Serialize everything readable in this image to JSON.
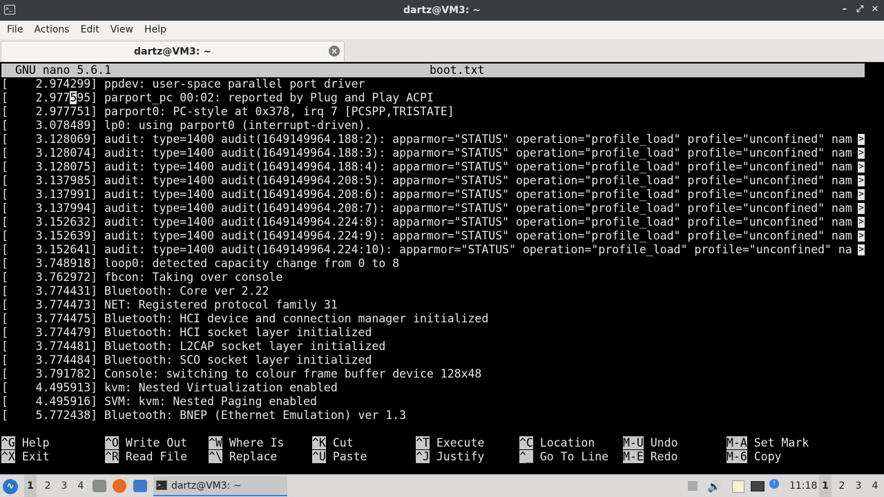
{
  "window": {
    "title": "dartz@VM3: ~"
  },
  "menu": [
    "File",
    "Actions",
    "Edit",
    "View",
    "Help"
  ],
  "tab": {
    "label": "dartz@VM3: ~"
  },
  "nano": {
    "version": "GNU nano 5.6.1",
    "filename": "boot.txt"
  },
  "lines": [
    "[    2.974299] ppdev: user-space parallel port driver",
    "[    2.977595] parport_pc 00:02: reported by Plug and Play ACPI",
    "[    2.977751] parport0: PC-style at 0x378, irq 7 [PCSPP,TRISTATE]",
    "[    3.078489] lp0: using parport0 (interrupt-driven).",
    "[    3.128069] audit: type=1400 audit(1649149964.188:2): apparmor=\"STATUS\" operation=\"profile_load\" profile=\"unconfined\" nam",
    "[    3.128074] audit: type=1400 audit(1649149964.188:3): apparmor=\"STATUS\" operation=\"profile_load\" profile=\"unconfined\" nam",
    "[    3.128075] audit: type=1400 audit(1649149964.188:4): apparmor=\"STATUS\" operation=\"profile_load\" profile=\"unconfined\" nam",
    "[    3.137985] audit: type=1400 audit(1649149964.208:5): apparmor=\"STATUS\" operation=\"profile_load\" profile=\"unconfined\" nam",
    "[    3.137991] audit: type=1400 audit(1649149964.208:6): apparmor=\"STATUS\" operation=\"profile_load\" profile=\"unconfined\" nam",
    "[    3.137994] audit: type=1400 audit(1649149964.208:7): apparmor=\"STATUS\" operation=\"profile_load\" profile=\"unconfined\" nam",
    "[    3.152632] audit: type=1400 audit(1649149964.224:8): apparmor=\"STATUS\" operation=\"profile_load\" profile=\"unconfined\" nam",
    "[    3.152639] audit: type=1400 audit(1649149964.224:9): apparmor=\"STATUS\" operation=\"profile_load\" profile=\"unconfined\" nam",
    "[    3.152641] audit: type=1400 audit(1649149964.224:10): apparmor=\"STATUS\" operation=\"profile_load\" profile=\"unconfined\" na",
    "[    3.748918] loop0: detected capacity change from 0 to 8",
    "[    3.762972] fbcon: Taking over console",
    "[    3.774431] Bluetooth: Core ver 2.22",
    "[    3.774473] NET: Registered protocol family 31",
    "[    3.774475] Bluetooth: HCI device and connection manager initialized",
    "[    3.774479] Bluetooth: HCI socket layer initialized",
    "[    3.774481] Bluetooth: L2CAP socket layer initialized",
    "[    3.774484] Bluetooth: SCO socket layer initialized",
    "[    3.791782] Console: switching to colour frame buffer device 128x48",
    "[    4.495913] kvm: Nested Virtualization enabled",
    "[    4.495916] SVM: kvm: Nested Paging enabled",
    "[    5.772438] Bluetooth: BNEP (Ethernet Emulation) ver 1.3"
  ],
  "truncation_marker": ">",
  "shortcuts_row1": [
    {
      "key": "^G",
      "label": "Help"
    },
    {
      "key": "^O",
      "label": "Write Out"
    },
    {
      "key": "^W",
      "label": "Where Is"
    },
    {
      "key": "^K",
      "label": "Cut"
    },
    {
      "key": "^T",
      "label": "Execute"
    },
    {
      "key": "^C",
      "label": "Location"
    },
    {
      "key": "M-U",
      "label": "Undo"
    },
    {
      "key": "M-A",
      "label": "Set Mark"
    }
  ],
  "shortcuts_row2": [
    {
      "key": "^X",
      "label": "Exit"
    },
    {
      "key": "^R",
      "label": "Read File"
    },
    {
      "key": "^\\",
      "label": "Replace"
    },
    {
      "key": "^U",
      "label": "Paste"
    },
    {
      "key": "^J",
      "label": "Justify"
    },
    {
      "key": "^_",
      "label": "Go To Line"
    },
    {
      "key": "M-E",
      "label": "Redo"
    },
    {
      "key": "M-6",
      "label": "Copy"
    }
  ],
  "taskbar": {
    "workspaces_left": [
      "1",
      "2",
      "3",
      "4"
    ],
    "task_label": "dartz@VM3: ~",
    "clock": "11:18",
    "workspaces_right": [
      "1",
      "2",
      "3",
      "4"
    ]
  }
}
